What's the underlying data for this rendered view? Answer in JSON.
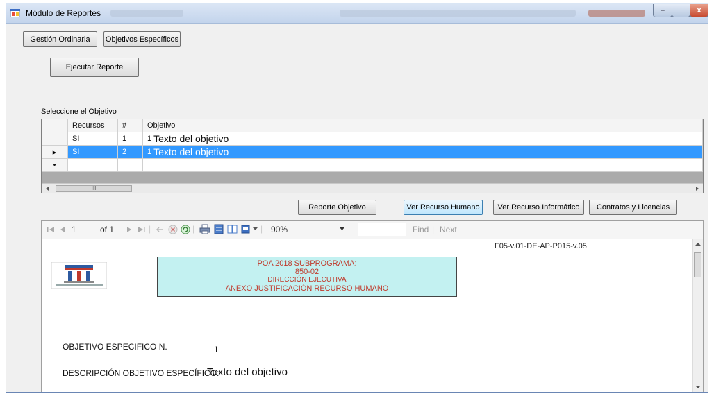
{
  "window": {
    "title": "Módulo de Reportes",
    "controls": {
      "minimize": "–",
      "maximize": "□",
      "close": "x"
    }
  },
  "top_buttons": {
    "gestion": "Gestión Ordinaria",
    "objetivos": "Objetivos Específicos",
    "ejecutar": "Ejecutar Reporte"
  },
  "grid": {
    "label": "Seleccione el Objetivo",
    "headers": [
      "Recursos",
      "#",
      "Objetivo"
    ],
    "rows": [
      {
        "recursos": "SI",
        "num": "1",
        "prefix": "1",
        "objetivo": "Texto del objetivo",
        "selected": false
      },
      {
        "recursos": "SI",
        "num": "2",
        "prefix": "1",
        "objetivo": "Texto del objetivo",
        "selected": true
      }
    ],
    "new_row_marker": "•",
    "current_row_marker": "▸",
    "scroll_thumb": "III"
  },
  "action_buttons": {
    "reporte": "Reporte Objetivo",
    "humano": "Ver Recurso Humano",
    "informatico": "Ver Recurso Informático",
    "contratos": "Contratos y Licencias"
  },
  "viewer_toolbar": {
    "page": "1",
    "of_label": "of 1",
    "zoom": "90%",
    "find": "Find",
    "separator": "|",
    "next": "Next"
  },
  "report": {
    "code": "F05-v.01-DE-AP-P015-v.05",
    "title_lines": [
      "POA 2018 SUBPROGRAMA:",
      "850-02",
      "DIRECCIÓN EJECUTIVA",
      "ANEXO JUSTIFICACIÓN RECURSO HUMANO"
    ],
    "objetivo_label": "OBJETIVO ESPECIFICO N.",
    "objetivo_value": "1",
    "descripcion_label": "DESCRIPCIÓN OBJETIVO ESPECÍFICO:",
    "descripcion_value": "Texto del objetivo"
  },
  "colors": {
    "selection": "#3399ff",
    "banner": "#c3f1f1",
    "banner_text": "#c0392b"
  }
}
